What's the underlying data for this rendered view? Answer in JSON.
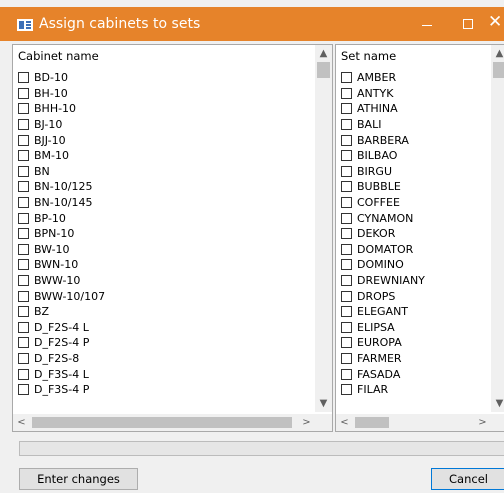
{
  "window": {
    "title": "Assign cabinets to sets",
    "controls": {
      "minimize": "minimize",
      "maximize": "maximize",
      "close": "✕"
    },
    "accent_color": "#e6832a"
  },
  "cabinets": {
    "header": "Cabinet name",
    "items": [
      "BD-10",
      "BH-10",
      "BHH-10",
      "BJ-10",
      "BJJ-10",
      "BM-10",
      "BN",
      "BN-10/125",
      "BN-10/145",
      "BP-10",
      "BPN-10",
      "BW-10",
      "BWN-10",
      "BWW-10",
      "BWW-10/107",
      "BZ",
      "D_F2S-4 L",
      "D_F2S-4 P",
      "D_F2S-8",
      "D_F3S-4 L",
      "D_F3S-4 P"
    ]
  },
  "sets": {
    "header": "Set name",
    "items": [
      "AMBER",
      "ANTYK",
      "ATHINA",
      "BALI",
      "BARBERA",
      "BILBAO",
      "BIRGU",
      "BUBBLE",
      "COFFEE",
      "CYNAMON",
      "DEKOR",
      "DOMATOR",
      "DOMINO",
      "DREWNIANY",
      "DROPS",
      "ELEGANT",
      "ELIPSA",
      "EUROPA",
      "FARMER",
      "FASADA",
      "FILAR"
    ]
  },
  "scroll_icons": {
    "up": "▲",
    "down": "▼",
    "left": "<",
    "right": ">"
  },
  "buttons": {
    "enter_changes": "Enter changes",
    "cancel": "Cancel"
  }
}
